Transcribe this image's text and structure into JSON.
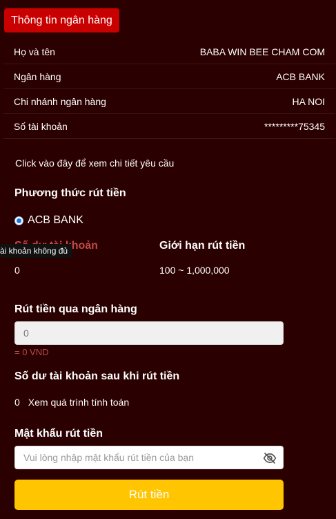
{
  "bank_tab": {
    "label": "Thông tin ngân hàng"
  },
  "info": {
    "rows": [
      {
        "label": "Họ và tên",
        "value": "BABA WIN BEE CHAM COM"
      },
      {
        "label": "Ngân hàng",
        "value": "ACB BANK"
      },
      {
        "label": "Chi nhánh ngân hàng",
        "value": "HA NOI"
      },
      {
        "label": "Số tài khoản",
        "value": "*********75345"
      }
    ]
  },
  "detail_link": "Click vào đây để xem chi tiết yêu cầu",
  "withdraw_method": {
    "title": "Phương thức rút tiền",
    "option_label": "ACB BANK",
    "selected": true
  },
  "balance": {
    "label": "Số dư tài khoản",
    "tooltip": "ài khoản không đủ",
    "value": "0"
  },
  "limit": {
    "label": "Giới hạn rút tiền",
    "value": "100 ~ 1,000,000"
  },
  "bank_withdraw": {
    "title": "Rút tiền qua ngân hàng",
    "input_value": "0",
    "converted": "= 0 VND"
  },
  "after_balance": {
    "title": "Số dư tài khoản sau khi rút tiền",
    "value": "0",
    "link": "Xem quá trình tính toán"
  },
  "password": {
    "title": "Mật khẩu rút tiền",
    "placeholder": "Vui lòng nhập mật khẩu rút tiền của bạn",
    "icon": "eye-slash-icon"
  },
  "submit": {
    "label": "Rút tiền"
  },
  "colors": {
    "background": "#2b0000",
    "tab": "#c80000",
    "accent_red": "#c24a4a",
    "button": "#ffc500"
  }
}
